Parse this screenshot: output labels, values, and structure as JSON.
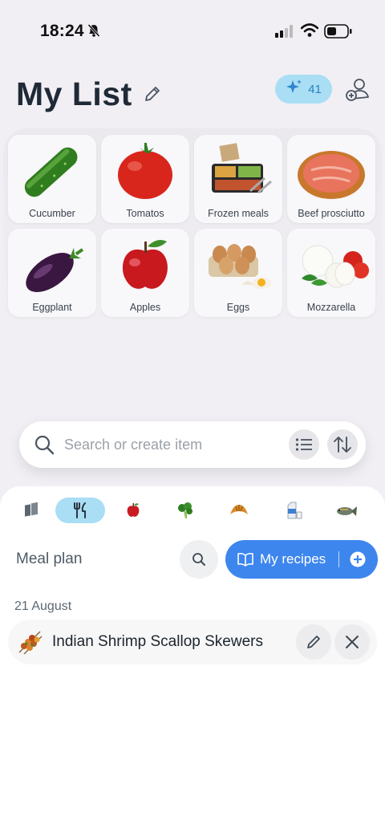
{
  "status_bar": {
    "time": "18:24"
  },
  "header": {
    "title": "My List",
    "ai_credits": "41"
  },
  "items": [
    {
      "label": "Cucumber",
      "icon": "cucumber-icon"
    },
    {
      "label": "Tomatos",
      "icon": "tomato-icon"
    },
    {
      "label": "Frozen meals",
      "icon": "frozen-meal-icon"
    },
    {
      "label": "Beef prosciutto",
      "icon": "prosciutto-icon"
    },
    {
      "label": "Eggplant",
      "icon": "eggplant-icon"
    },
    {
      "label": "Apples",
      "icon": "apple-icon"
    },
    {
      "label": "Eggs",
      "icon": "eggs-icon"
    },
    {
      "label": "Mozzarella",
      "icon": "mozzarella-icon"
    }
  ],
  "search": {
    "placeholder": "Search or create item"
  },
  "categories": [
    "all-icon",
    "cutlery-icon",
    "apple-icon",
    "broccoli-icon",
    "croissant-icon",
    "milk-icon",
    "fish-icon"
  ],
  "meal_plan": {
    "label": "Meal plan",
    "recipes_button": "My recipes",
    "date": "21 August",
    "meals": [
      {
        "name": "Indian Shrimp Scallop Skewers",
        "icon": "skewer-icon"
      }
    ]
  },
  "colors": {
    "accent_blue": "#3d86ee",
    "badge_blue": "#a9def5"
  }
}
